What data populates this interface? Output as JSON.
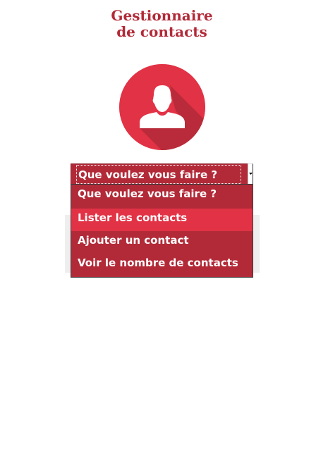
{
  "header": {
    "title_line1": "Gestionnaire",
    "title_line2": "de contacts"
  },
  "avatar": {
    "icon": "user-icon",
    "color": "#e23245",
    "shadow_color": "#b22a38"
  },
  "select": {
    "current_value": "Que voulez vous faire ?",
    "options": [
      "Que voulez vous faire ?",
      "Lister les contacts",
      "Ajouter un contact",
      "Voir le nombre de contacts"
    ],
    "highlighted_option": "Lister les contacts"
  },
  "colors": {
    "brand": "#b22a38",
    "highlight": "#e23245",
    "text_on_brand": "#ffffff"
  }
}
